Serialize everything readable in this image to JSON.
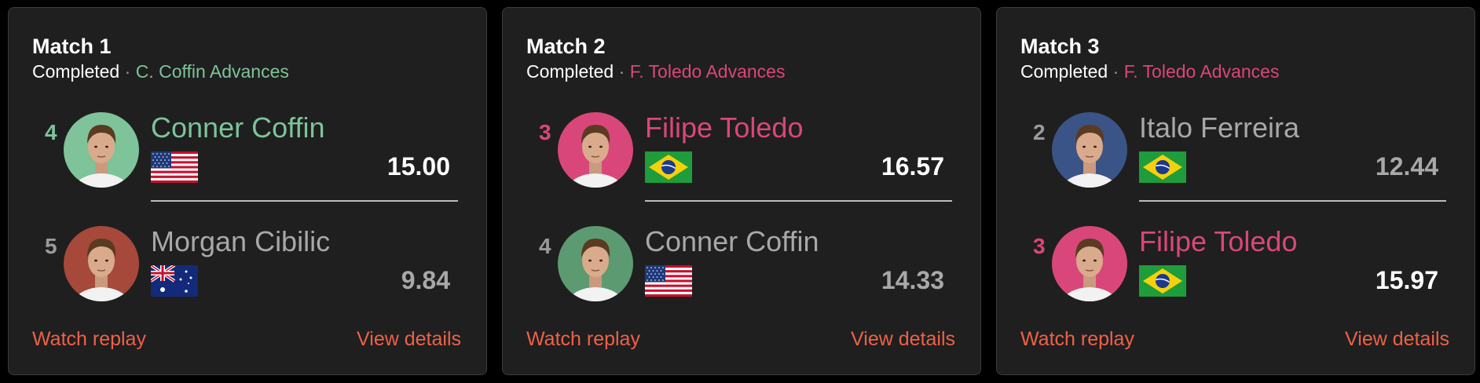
{
  "colors": {
    "background": "#000000",
    "card": "#1f1f1f",
    "winner_green": "#7ec39a",
    "winner_pink": "#d9477a",
    "link": "#ef6148",
    "loser_text": "#a8a8a8"
  },
  "matches": [
    {
      "title": "Match 1",
      "status": "Completed",
      "separator": "·",
      "advance_text": "C. Coffin Advances",
      "players": [
        {
          "seed": "4",
          "name": "Conner Coffin",
          "flag": "usa-flag-icon",
          "score": "15.00",
          "avatar_color": "#7ec39a"
        },
        {
          "seed": "5",
          "name": "Morgan Cibilic",
          "flag": "australia-flag-icon",
          "score": "9.84",
          "avatar_color": "#a6483a"
        }
      ],
      "watch_label": "Watch replay",
      "details_label": "View details"
    },
    {
      "title": "Match 2",
      "status": "Completed",
      "separator": "·",
      "advance_text": "F. Toledo Advances",
      "players": [
        {
          "seed": "3",
          "name": "Filipe Toledo",
          "flag": "brazil-flag-icon",
          "score": "16.57",
          "avatar_color": "#d9477a"
        },
        {
          "seed": "4",
          "name": "Conner Coffin",
          "flag": "usa-flag-icon",
          "score": "14.33",
          "avatar_color": "#5c9a72"
        }
      ],
      "watch_label": "Watch replay",
      "details_label": "View details"
    },
    {
      "title": "Match 3",
      "status": "Completed",
      "separator": "·",
      "advance_text": "F. Toledo Advances",
      "players": [
        {
          "seed": "2",
          "name": "Italo Ferreira",
          "flag": "brazil-flag-icon",
          "score": "12.44",
          "avatar_color": "#3b5487"
        },
        {
          "seed": "3",
          "name": "Filipe Toledo",
          "flag": "brazil-flag-icon",
          "score": "15.97",
          "avatar_color": "#d9477a"
        }
      ],
      "watch_label": "Watch replay",
      "details_label": "View details"
    }
  ]
}
